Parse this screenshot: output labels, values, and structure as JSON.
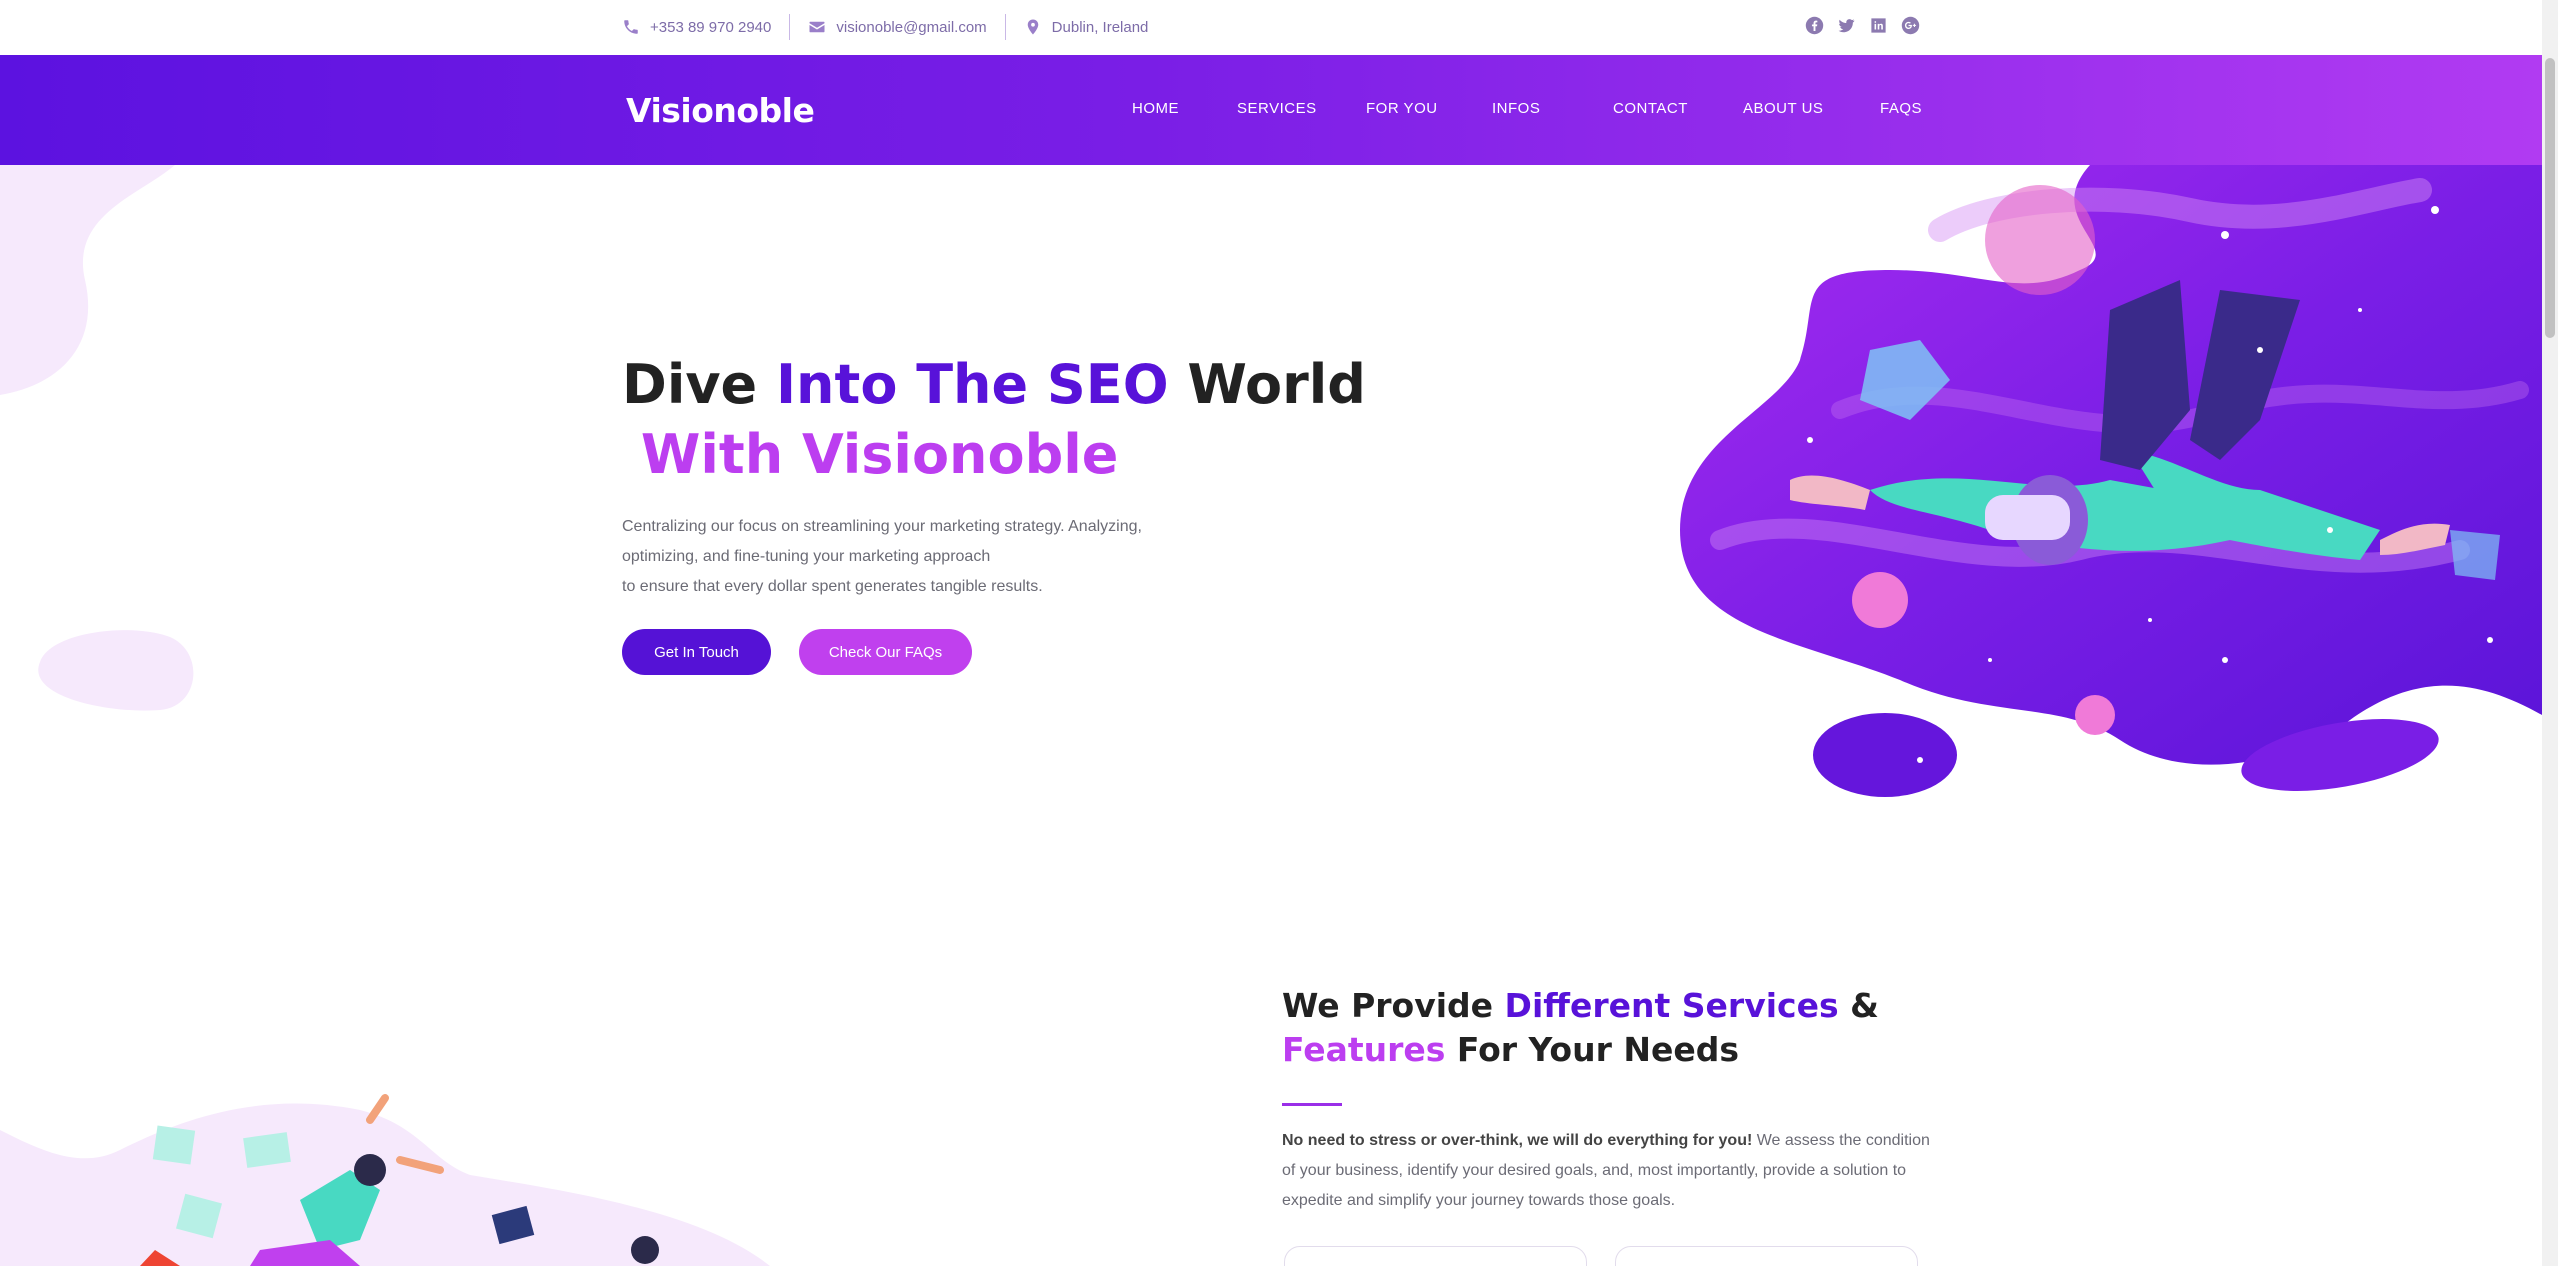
{
  "topbar": {
    "phone": "+353 89 970 2940",
    "email": "visionoble@gmail.com",
    "location": "Dublin, Ireland",
    "icons": [
      "phone-icon",
      "envelope-icon",
      "map-marker-icon"
    ],
    "social": [
      "facebook-icon",
      "twitter-icon",
      "linkedin-icon",
      "google-plus-icon"
    ]
  },
  "nav": {
    "logo": "Visionoble",
    "items": [
      "HOME",
      "SERVICES",
      "FOR YOU",
      "INFOS",
      "CONTACT",
      "ABOUT US",
      "FAQS"
    ]
  },
  "hero": {
    "title_part1": "Dive ",
    "title_part2": "Into The SEO",
    "title_part3": " World",
    "title_line2": "With Visionoble",
    "desc_line1": "Centralizing our focus on streamlining your marketing strategy. Analyzing,",
    "desc_line2": "optimizing, and fine-tuning your marketing approach",
    "desc_line3": "to ensure that every dollar spent generates tangible results.",
    "btn_primary": "Get In Touch",
    "btn_secondary": "Check Our FAQs"
  },
  "services": {
    "title_a": "We Provide ",
    "title_b": "Different Services",
    "title_c": " &",
    "title_d": "Features",
    "title_e": " For Your Needs",
    "desc_bold": "No need to stress or over-think, we will do everything for you!",
    "desc_rest": " We assess the condition of your business, identify your desired goals, and, most importantly, provide a solution to expedite and simplify your journey towards those goals."
  },
  "colors": {
    "primary": "#5812d9",
    "accent": "#bc3ef0",
    "nav_gradient_start": "#5c12e0",
    "nav_gradient_end": "#b13bf2"
  }
}
